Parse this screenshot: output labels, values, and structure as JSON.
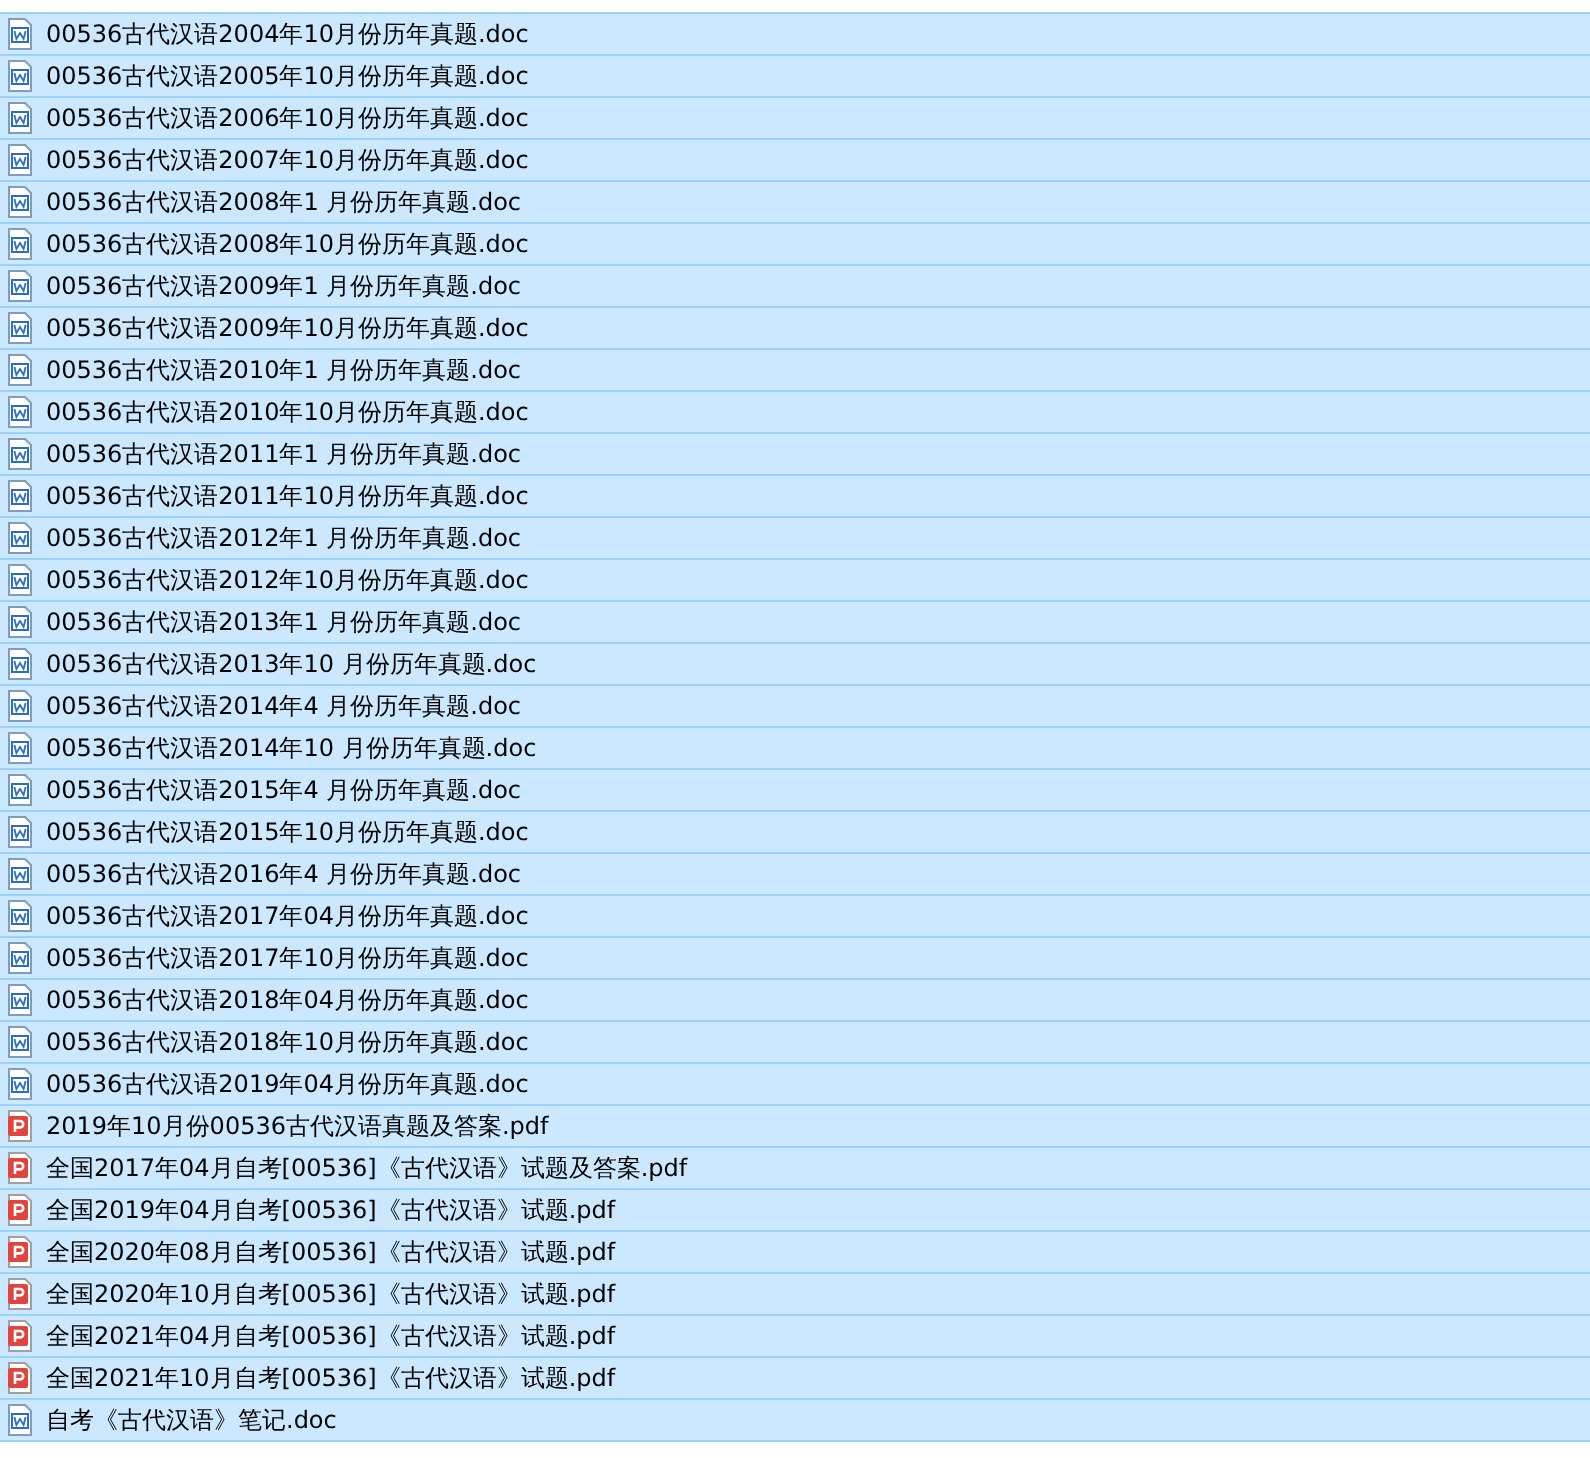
{
  "files": [
    {
      "name": "00536古代汉语2004年10月份历年真题.doc",
      "kind": "doc",
      "selected": true
    },
    {
      "name": "00536古代汉语2005年10月份历年真题.doc",
      "kind": "doc",
      "selected": true
    },
    {
      "name": "00536古代汉语2006年10月份历年真题.doc",
      "kind": "doc",
      "selected": true
    },
    {
      "name": "00536古代汉语2007年10月份历年真题.doc",
      "kind": "doc",
      "selected": true
    },
    {
      "name": "00536古代汉语2008年1 月份历年真题.doc",
      "kind": "doc",
      "selected": true
    },
    {
      "name": "00536古代汉语2008年10月份历年真题.doc",
      "kind": "doc",
      "selected": true
    },
    {
      "name": "00536古代汉语2009年1 月份历年真题.doc",
      "kind": "doc",
      "selected": true
    },
    {
      "name": "00536古代汉语2009年10月份历年真题.doc",
      "kind": "doc",
      "selected": true
    },
    {
      "name": "00536古代汉语2010年1 月份历年真题.doc",
      "kind": "doc",
      "selected": true
    },
    {
      "name": "00536古代汉语2010年10月份历年真题.doc",
      "kind": "doc",
      "selected": true
    },
    {
      "name": "00536古代汉语2011年1 月份历年真题.doc",
      "kind": "doc",
      "selected": true
    },
    {
      "name": "00536古代汉语2011年10月份历年真题.doc",
      "kind": "doc",
      "selected": true
    },
    {
      "name": "00536古代汉语2012年1 月份历年真题.doc",
      "kind": "doc",
      "selected": true
    },
    {
      "name": "00536古代汉语2012年10月份历年真题.doc",
      "kind": "doc",
      "selected": true
    },
    {
      "name": "00536古代汉语2013年1 月份历年真题.doc",
      "kind": "doc",
      "selected": true
    },
    {
      "name": "00536古代汉语2013年10 月份历年真题.doc",
      "kind": "doc",
      "selected": true
    },
    {
      "name": "00536古代汉语2014年4 月份历年真题.doc",
      "kind": "doc",
      "selected": true
    },
    {
      "name": "00536古代汉语2014年10 月份历年真题.doc",
      "kind": "doc",
      "selected": true
    },
    {
      "name": "00536古代汉语2015年4 月份历年真题.doc",
      "kind": "doc",
      "selected": true
    },
    {
      "name": "00536古代汉语2015年10月份历年真题.doc",
      "kind": "doc",
      "selected": true
    },
    {
      "name": "00536古代汉语2016年4 月份历年真题.doc",
      "kind": "doc",
      "selected": true
    },
    {
      "name": "00536古代汉语2017年04月份历年真题.doc",
      "kind": "doc",
      "selected": true
    },
    {
      "name": "00536古代汉语2017年10月份历年真题.doc",
      "kind": "doc",
      "selected": true
    },
    {
      "name": "00536古代汉语2018年04月份历年真题.doc",
      "kind": "doc",
      "selected": true
    },
    {
      "name": "00536古代汉语2018年10月份历年真题.doc",
      "kind": "doc",
      "selected": true
    },
    {
      "name": "00536古代汉语2019年04月份历年真题.doc",
      "kind": "doc",
      "selected": true
    },
    {
      "name": "2019年10月份00536古代汉语真题及答案.pdf",
      "kind": "pdf",
      "selected": true
    },
    {
      "name": "全国2017年04月自考[00536]《古代汉语》试题及答案.pdf",
      "kind": "pdf",
      "selected": true
    },
    {
      "name": "全国2019年04月自考[00536]《古代汉语》试题.pdf",
      "kind": "pdf",
      "selected": true
    },
    {
      "name": "全国2020年08月自考[00536]《古代汉语》试题.pdf",
      "kind": "pdf",
      "selected": true
    },
    {
      "name": "全国2020年10月自考[00536]《古代汉语》试题.pdf",
      "kind": "pdf",
      "selected": true
    },
    {
      "name": "全国2021年04月自考[00536]《古代汉语》试题.pdf",
      "kind": "pdf",
      "selected": true
    },
    {
      "name": "全国2021年10月自考[00536]《古代汉语》试题.pdf",
      "kind": "pdf",
      "selected": true
    },
    {
      "name": "自考《古代汉语》笔记.doc",
      "kind": "doc",
      "selected": true
    }
  ]
}
